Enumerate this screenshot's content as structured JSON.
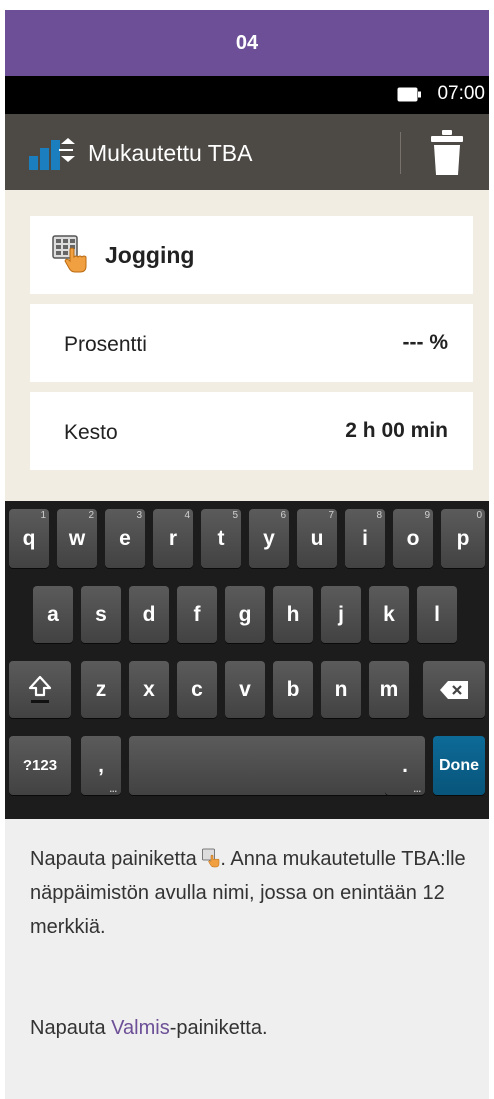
{
  "step": {
    "number": "04"
  },
  "status": {
    "time": "07:00",
    "battery_icon": "battery-icon"
  },
  "header": {
    "title": "Mukautettu TBA",
    "icon": "custom-tba-icon",
    "delete_icon": "trash-icon"
  },
  "fields": {
    "name": {
      "value": "Jogging",
      "icon": "keypad-icon"
    },
    "percent": {
      "label": "Prosentti",
      "value": "--- %"
    },
    "duration": {
      "label": "Kesto",
      "value": "2 h 00 min"
    }
  },
  "keyboard": {
    "row1": [
      "q",
      "w",
      "e",
      "r",
      "t",
      "y",
      "u",
      "i",
      "o",
      "p"
    ],
    "row1_numbers": [
      "1",
      "2",
      "3",
      "4",
      "5",
      "6",
      "7",
      "8",
      "9",
      "0"
    ],
    "row2": [
      "a",
      "s",
      "d",
      "f",
      "g",
      "h",
      "j",
      "k",
      "l"
    ],
    "row3": [
      "z",
      "x",
      "c",
      "v",
      "b",
      "n",
      "m"
    ],
    "symbols_label": "?123",
    "comma_label": ",",
    "period_label": ".",
    "done_label": "Done",
    "shift_icon": "shift-icon",
    "backspace_icon": "backspace-icon"
  },
  "instructions": {
    "p1_before": "Napauta painiketta ",
    "p1_after": ". Anna mukautetulle TBA:lle näppäimistön avulla nimi, jossa on enintään 12 merkkiä.",
    "p2_before": "Napauta ",
    "p2_link": "Valmis",
    "p2_after": "-painiketta."
  },
  "colors": {
    "accent": "#6c4f97",
    "titlebar": "#4d4944",
    "done_key": "#0d6a97",
    "background": "#f1ede2"
  }
}
